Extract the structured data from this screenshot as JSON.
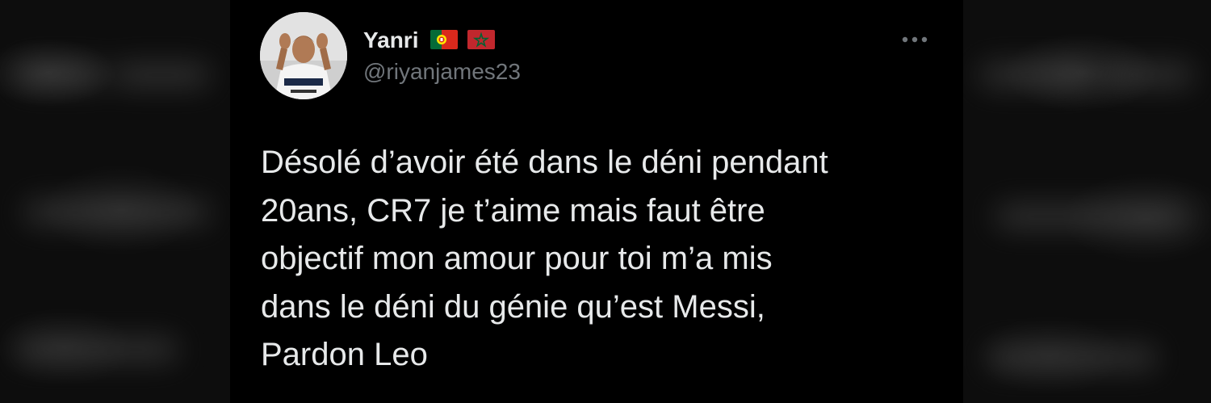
{
  "tweet": {
    "display_name": "Yanri",
    "handle": "@riyanjames23",
    "text": "Désolé d’avoir été dans le déni pendant\n20ans, CR7 je t’aime mais faut être\nobjectif mon amour pour toi m’a mis\ndans le déni du génie qu’est Messi,\nPardon Leo",
    "flags": [
      "portugal-flag-icon",
      "morocco-flag-icon"
    ],
    "menu_icon": "more-horizontal-icon",
    "avatar_icon": "profile-avatar"
  },
  "colors": {
    "card_background": "#000000",
    "primary_text": "#e7e9ea",
    "secondary_text": "#71767b"
  }
}
